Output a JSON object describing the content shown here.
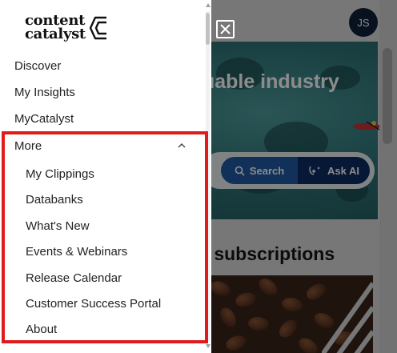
{
  "background": {
    "hero_title": "luable industry",
    "search_label": "Search",
    "ask_ai_label": "Ask AI",
    "subscriptions_heading": "r subscriptions",
    "avatar_initials": "JS",
    "colors": {
      "search": "#1f5aa6",
      "ask_ai": "#0e2a63"
    }
  },
  "drawer": {
    "logo": {
      "line1": "content",
      "line2": "catalyst"
    },
    "nav": [
      {
        "label": "Discover"
      },
      {
        "label": "My Insights"
      },
      {
        "label": "MyCatalyst"
      }
    ],
    "more": {
      "label": "More",
      "expanded": true,
      "items": [
        {
          "label": "My Clippings"
        },
        {
          "label": "Databanks"
        },
        {
          "label": "What's New"
        },
        {
          "label": "Events & Webinars"
        },
        {
          "label": "Release Calendar"
        },
        {
          "label": "Customer Success Portal"
        },
        {
          "label": "About"
        }
      ]
    },
    "highlight_color": "#e01b1b"
  },
  "icons": {
    "close": "close-icon",
    "chevron": "chevron-up-icon",
    "search": "search-icon",
    "ask_ai": "sparkle-icon",
    "logo_mark": "logo-c-icon"
  }
}
